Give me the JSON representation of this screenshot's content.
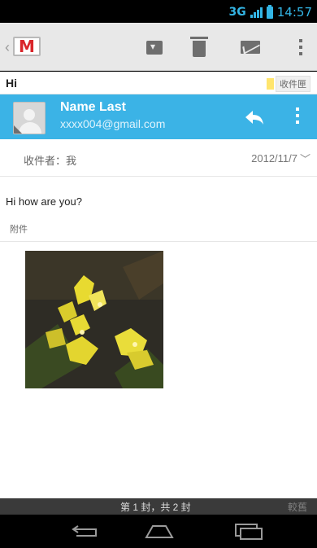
{
  "status_bar": {
    "network": "3G",
    "time": "14:57",
    "icons": [
      "signal-icon",
      "battery-icon"
    ],
    "accent_color": "#33b5e5"
  },
  "action_bar": {
    "icons": [
      "gmail-logo",
      "archive-icon",
      "trash-icon",
      "mail-icon",
      "overflow-menu-icon"
    ]
  },
  "message": {
    "subject": "Hi",
    "label": "收件匣",
    "sender_name": "Name Last",
    "sender_email": "xxxx004@gmail.com",
    "recipient": "收件者：我",
    "date": "2012/11/7",
    "body": "Hi how are you?",
    "attachment_label": "附件",
    "header_color": "#3bb3e6"
  },
  "pager": {
    "position": "第 1 封，共 2 封",
    "older": "較舊"
  },
  "nav_bar": {
    "icons": [
      "back-icon",
      "home-icon",
      "recents-icon"
    ]
  }
}
